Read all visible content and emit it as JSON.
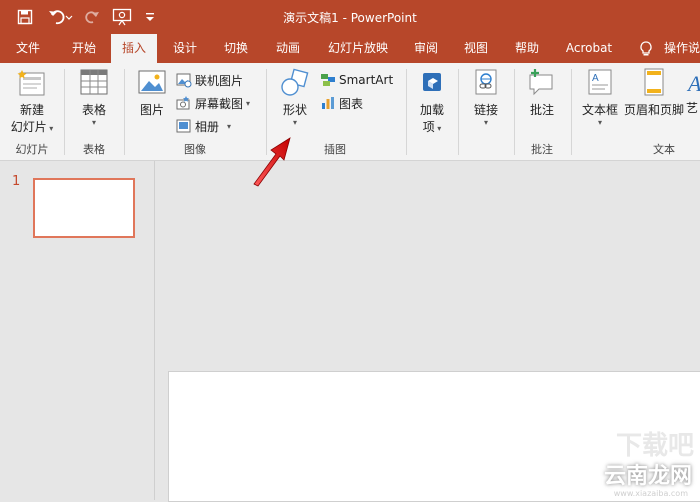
{
  "window": {
    "title": "演示文稿1  -  PowerPoint"
  },
  "tabs": [
    {
      "label": "文件"
    },
    {
      "label": "开始"
    },
    {
      "label": "插入"
    },
    {
      "label": "设计"
    },
    {
      "label": "切换"
    },
    {
      "label": "动画"
    },
    {
      "label": "幻灯片放映"
    },
    {
      "label": "审阅"
    },
    {
      "label": "视图"
    },
    {
      "label": "帮助"
    },
    {
      "label": "Acrobat"
    },
    {
      "label": "操作说"
    }
  ],
  "active_tab": "插入",
  "ribbon": {
    "new_slide": {
      "line1": "新建",
      "line2": "幻灯片"
    },
    "table": {
      "label": "表格"
    },
    "picture": {
      "label": "图片"
    },
    "online_pictures": {
      "label": "联机图片"
    },
    "screenshot": {
      "label": "屏幕截图"
    },
    "album": {
      "label": "相册"
    },
    "shapes": {
      "label": "形状"
    },
    "smartart": {
      "label": "SmartArt"
    },
    "chart": {
      "label": "图表"
    },
    "addins": {
      "line1": "加载",
      "line2": "项"
    },
    "link": {
      "label": "链接"
    },
    "comment": {
      "label": "批注"
    },
    "textbox": {
      "label": "文本框"
    },
    "header_footer": {
      "label": "页眉和页脚"
    },
    "wordart": {
      "label": "艺"
    },
    "groups": {
      "slides": "幻灯片",
      "tables": "表格",
      "images": "图像",
      "illustrations": "插图",
      "comments": "批注",
      "text": "文本"
    }
  },
  "thumbnail": {
    "number": "1"
  },
  "watermark": {
    "main": "云南龙网",
    "sub": "www.xiazaiba.com",
    "faint": "下载吧"
  },
  "colors": {
    "accent": "#b7472a",
    "ribbon_bg": "#f3f3f3",
    "canvas_bg": "#e6e6e6",
    "arrow": "#e02020"
  }
}
